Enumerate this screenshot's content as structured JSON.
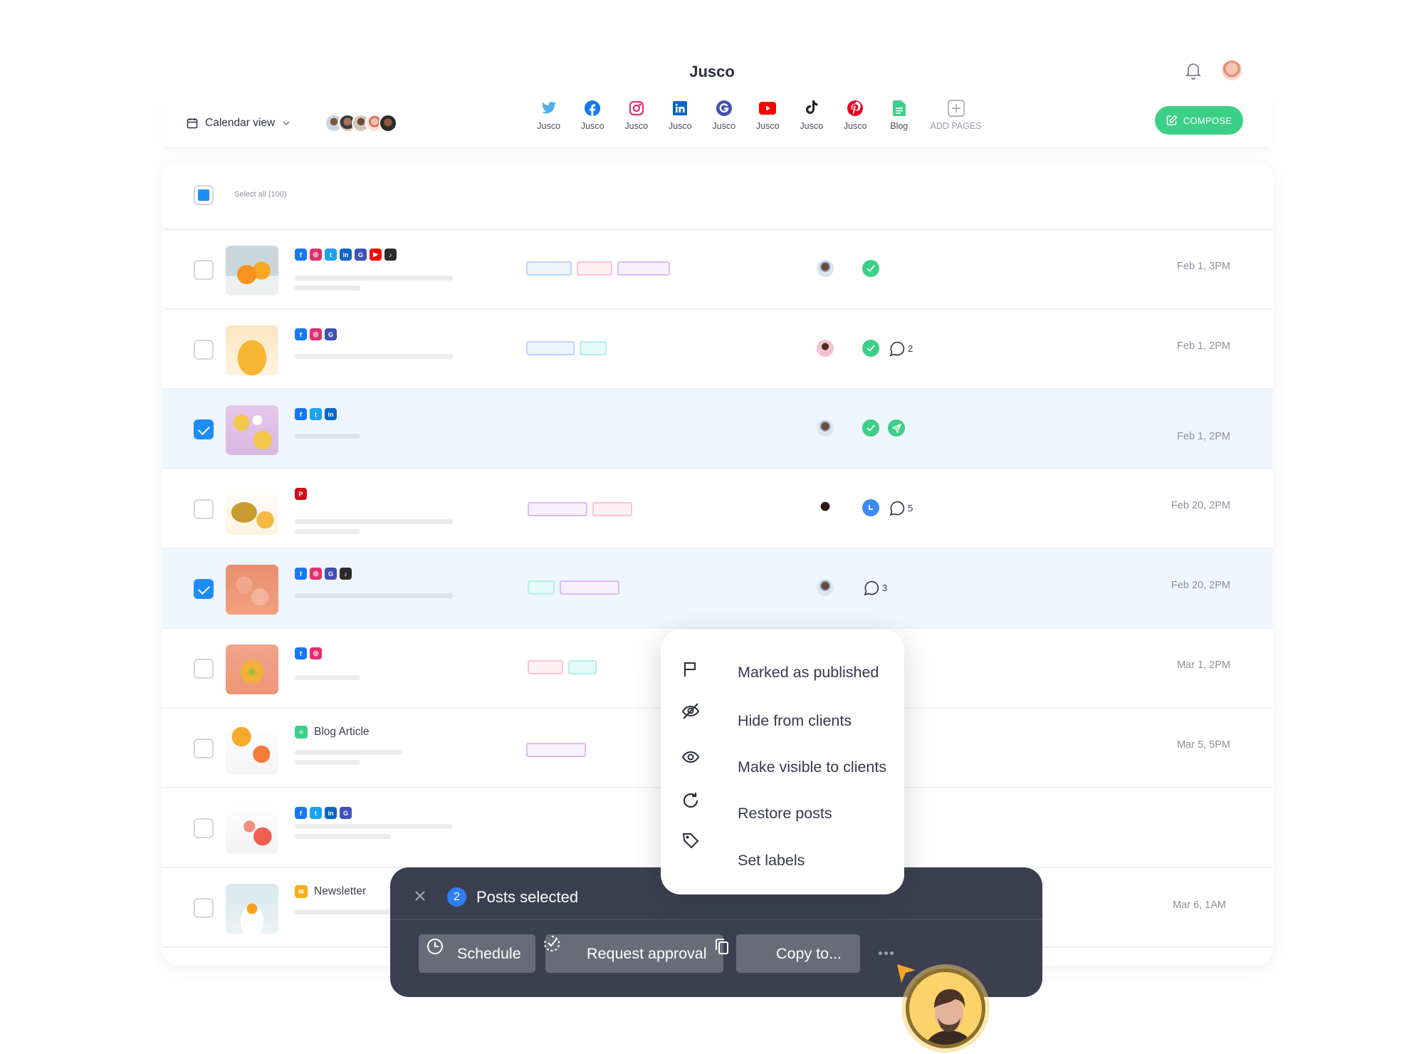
{
  "app": {
    "title": "Jusco",
    "notifications_icon": "bell-icon",
    "user_avatar": "user-avatar"
  },
  "toolbar": {
    "view_selector": {
      "label": "Calendar view",
      "icon": "calendar-icon",
      "chevron": "chevron-down-icon"
    },
    "team_member_count": 5,
    "channels": [
      {
        "network": "twitter",
        "label": "Jusco",
        "color": "#55acee"
      },
      {
        "network": "facebook",
        "label": "Jusco",
        "color": "#1877f2"
      },
      {
        "network": "instagram",
        "label": "Jusco",
        "color": "#e1306c"
      },
      {
        "network": "linkedin",
        "label": "Jusco",
        "color": "#0a66c2"
      },
      {
        "network": "google",
        "label": "Jusco",
        "color": "#3f51b5"
      },
      {
        "network": "youtube",
        "label": "Jusco",
        "color": "#ff0000"
      },
      {
        "network": "tiktok",
        "label": "Jusco",
        "color": "#222222"
      },
      {
        "network": "pinterest",
        "label": "Jusco",
        "color": "#e60023"
      },
      {
        "network": "blog",
        "label": "Blog",
        "color": "#3ccf87"
      }
    ],
    "add_pages_label": "ADD PAGES",
    "compose_label": "COMPOSE",
    "compose_color": "#3ccf87"
  },
  "list": {
    "select_all_label": "Select all (100)",
    "rows": [
      {
        "selected": false,
        "thumb": "oranges",
        "networks": [
          "facebook",
          "instagram",
          "twitter",
          "linkedin",
          "google",
          "youtube",
          "tiktok"
        ],
        "tags": [
          "blue",
          "pink",
          "purple"
        ],
        "assignee": "avatar-man-1",
        "status": [
          "approved"
        ],
        "comments": null,
        "date": "Feb 1, 3PM"
      },
      {
        "selected": false,
        "thumb": "juice",
        "networks": [
          "facebook",
          "instagram",
          "google"
        ],
        "tags": [
          "blue",
          "cyan"
        ],
        "assignee": "avatar-woman-pink",
        "status": [
          "approved"
        ],
        "comments": "2",
        "date": "Feb 1, 2PM"
      },
      {
        "selected": true,
        "thumb": "mango",
        "networks": [
          "facebook",
          "twitter",
          "linkedin"
        ],
        "tags": [],
        "assignee": "avatar-man-1",
        "status": [
          "approved",
          "sent"
        ],
        "comments": null,
        "date": "Feb 1, 2PM"
      },
      {
        "selected": false,
        "thumb": "pineapple",
        "networks": [
          "pinterest"
        ],
        "tags": [
          "purple",
          "pink"
        ],
        "assignee": "avatar-woman-dark",
        "status": [
          "scheduled"
        ],
        "comments": "5",
        "date": "Feb 20, 2PM"
      },
      {
        "selected": true,
        "thumb": "smoothies",
        "networks": [
          "facebook",
          "instagram",
          "google",
          "tiktok"
        ],
        "tags": [
          "cyan",
          "purple"
        ],
        "assignee": "avatar-man-1",
        "status": [],
        "comments": "3",
        "date": "Feb 20, 2PM"
      },
      {
        "selected": false,
        "thumb": "grapefruit",
        "networks": [
          "facebook",
          "instagram"
        ],
        "tags": [
          "pink",
          "cyan"
        ],
        "assignee": null,
        "status": [],
        "comments": null,
        "date": "Mar 1, 2PM"
      },
      {
        "selected": false,
        "thumb": "orange-slice",
        "type_label": "Blog Article",
        "type_icon": "blog",
        "networks": [],
        "tags": [
          "purple"
        ],
        "assignee": null,
        "status": [],
        "comments": null,
        "date": "Mar 5, 5PM"
      },
      {
        "selected": false,
        "thumb": "grapefruit-2",
        "networks": [
          "facebook",
          "twitter",
          "linkedin",
          "google"
        ],
        "tags": [],
        "assignee": null,
        "status": [],
        "comments": null,
        "date": ""
      },
      {
        "selected": false,
        "thumb": "fruit-bowl",
        "type_label": "Newsletter",
        "type_icon": "newsletter",
        "networks": [],
        "tags": [],
        "assignee": null,
        "status": [],
        "comments": null,
        "date": "Mar 6, 1AM"
      }
    ]
  },
  "context_menu": {
    "items": [
      {
        "icon": "flag-icon",
        "label": "Marked as published"
      },
      {
        "icon": "eye-off-icon",
        "label": "Hide from clients"
      },
      {
        "icon": "eye-icon",
        "label": "Make visible to clients"
      },
      {
        "icon": "refresh-icon",
        "label": "Restore posts"
      },
      {
        "icon": "tag-icon",
        "label": "Set labels"
      }
    ]
  },
  "selection_bar": {
    "count": "2",
    "title": "Posts selected",
    "actions": [
      {
        "icon": "clock-icon",
        "label": "Schedule"
      },
      {
        "icon": "approval-check-icon",
        "label": "Request approval"
      },
      {
        "icon": "copy-icon",
        "label": "Copy to..."
      }
    ],
    "more_icon": "more-horizontal-icon"
  },
  "colors": {
    "accent_blue": "#1e8cfb",
    "success_green": "#3ccf87",
    "bar_dark": "#3c3f4f",
    "selected_row_bg": "#eff6ff"
  }
}
